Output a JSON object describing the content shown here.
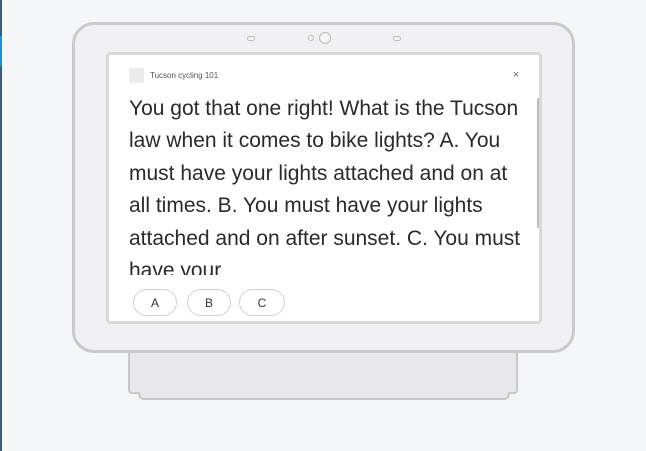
{
  "app": {
    "title": "Tucson cycling 101",
    "close_glyph": "×"
  },
  "message": {
    "text": "You got that one right! What is the Tucson law when it comes to bike lights? A. You must have your lights attached and on at all times. B. You must have your lights attached and on after sunset. C. You must have your"
  },
  "suggestions": [
    {
      "label": "A"
    },
    {
      "label": "B"
    },
    {
      "label": "C"
    }
  ],
  "colors": {
    "background": "#f4f6f8",
    "device_frame": "#c9c9ce",
    "screen": "#ffffff",
    "text": "#2a2a2a"
  }
}
